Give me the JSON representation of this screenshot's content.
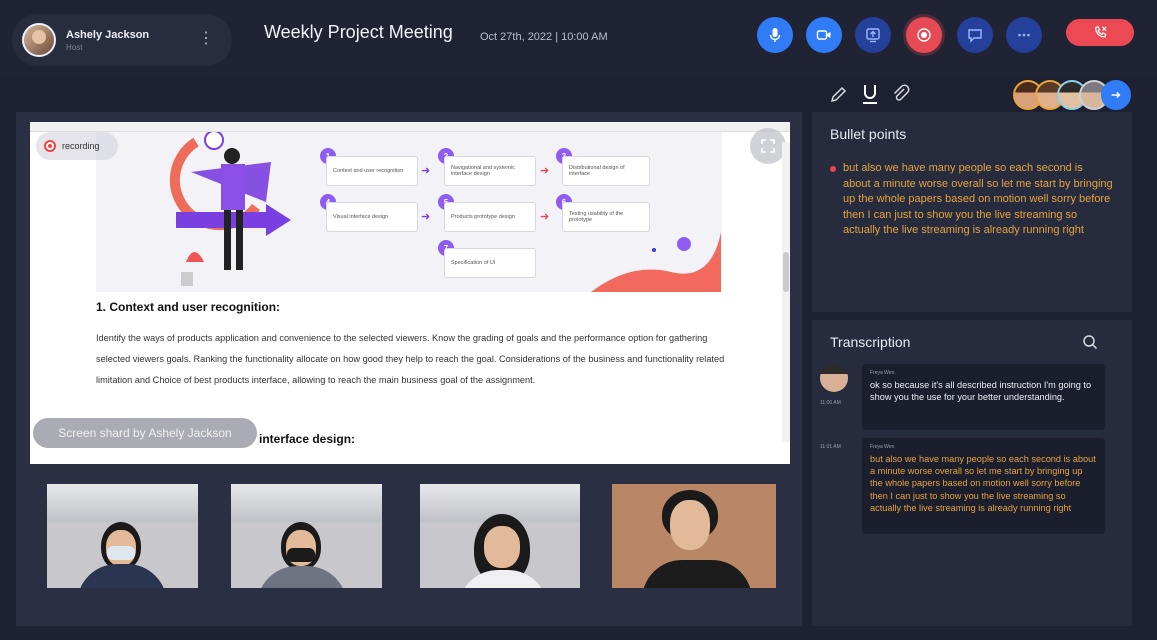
{
  "host": {
    "name": "Ashely Jackson",
    "role": "Host"
  },
  "meeting": {
    "title": "Weekly Project Meeting",
    "datetime": "Oct  27th, 2022 | 10:00 AM"
  },
  "controls": {
    "mic": "mic-icon",
    "camera": "camera-icon",
    "share": "share-screen-icon",
    "record": "record-icon",
    "chat": "chat-icon",
    "more": "more-icon",
    "end": "end-call-icon"
  },
  "shared_screen": {
    "recording_label": "recording",
    "steps": [
      {
        "num": "1",
        "label": "Context and user recognition"
      },
      {
        "num": "2",
        "label": "Navigational and systemic interface design"
      },
      {
        "num": "3",
        "label": "Distributional design of interface"
      },
      {
        "num": "4",
        "label": "Visual interface design"
      },
      {
        "num": "5",
        "label": "Products prototype design"
      },
      {
        "num": "6",
        "label": "Testing usability of the prototype"
      },
      {
        "num": "7",
        "label": "Specification of UI"
      }
    ],
    "heading": "1. Context and user recognition:",
    "paragraph": "Identify the ways of products application and convenience to the selected viewers. Know the grading of goals and the performance option for gathering selected viewers goals. Ranking the functionality allocate on how good they help to reach the goal. Considerations of the business and functionality related limitation and Choice of best products interface, allowing to reach the main business goal of the assignment.",
    "heading2": "interface design:",
    "share_label": "Screen shard by Ashely Jackson"
  },
  "participants": [
    {
      "name": "participant-1"
    },
    {
      "name": "participant-2"
    },
    {
      "name": "participant-3"
    },
    {
      "name": "participant-4"
    }
  ],
  "bullet_points": {
    "title": "Bullet points",
    "items": [
      "but also we have many people so each second is about a minute worse overall so let me start by bringing up the whole papers based on motion well sorry before then I can just to show you the live streaming so actually the live streaming is already running right"
    ]
  },
  "transcription": {
    "title": "Transcription",
    "messages": [
      {
        "sender": "Freya Wen",
        "time": "11:00 AM",
        "text": "ok so because it's all described instruction I'm going to show you the use for your better understanding."
      },
      {
        "sender": "Freya Wen",
        "time": "11:01 AM",
        "text": "but also we have many people so each second is about a minute worse overall so let me start by bringing up the whole papers based on motion well sorry before then I can just to show you the live streaming so actually the live streaming is already running right"
      }
    ]
  },
  "colors": {
    "accent": "#2f7cf6",
    "record": "#e54a55",
    "highlight": "#e6a33d",
    "panel": "#262b3d"
  }
}
